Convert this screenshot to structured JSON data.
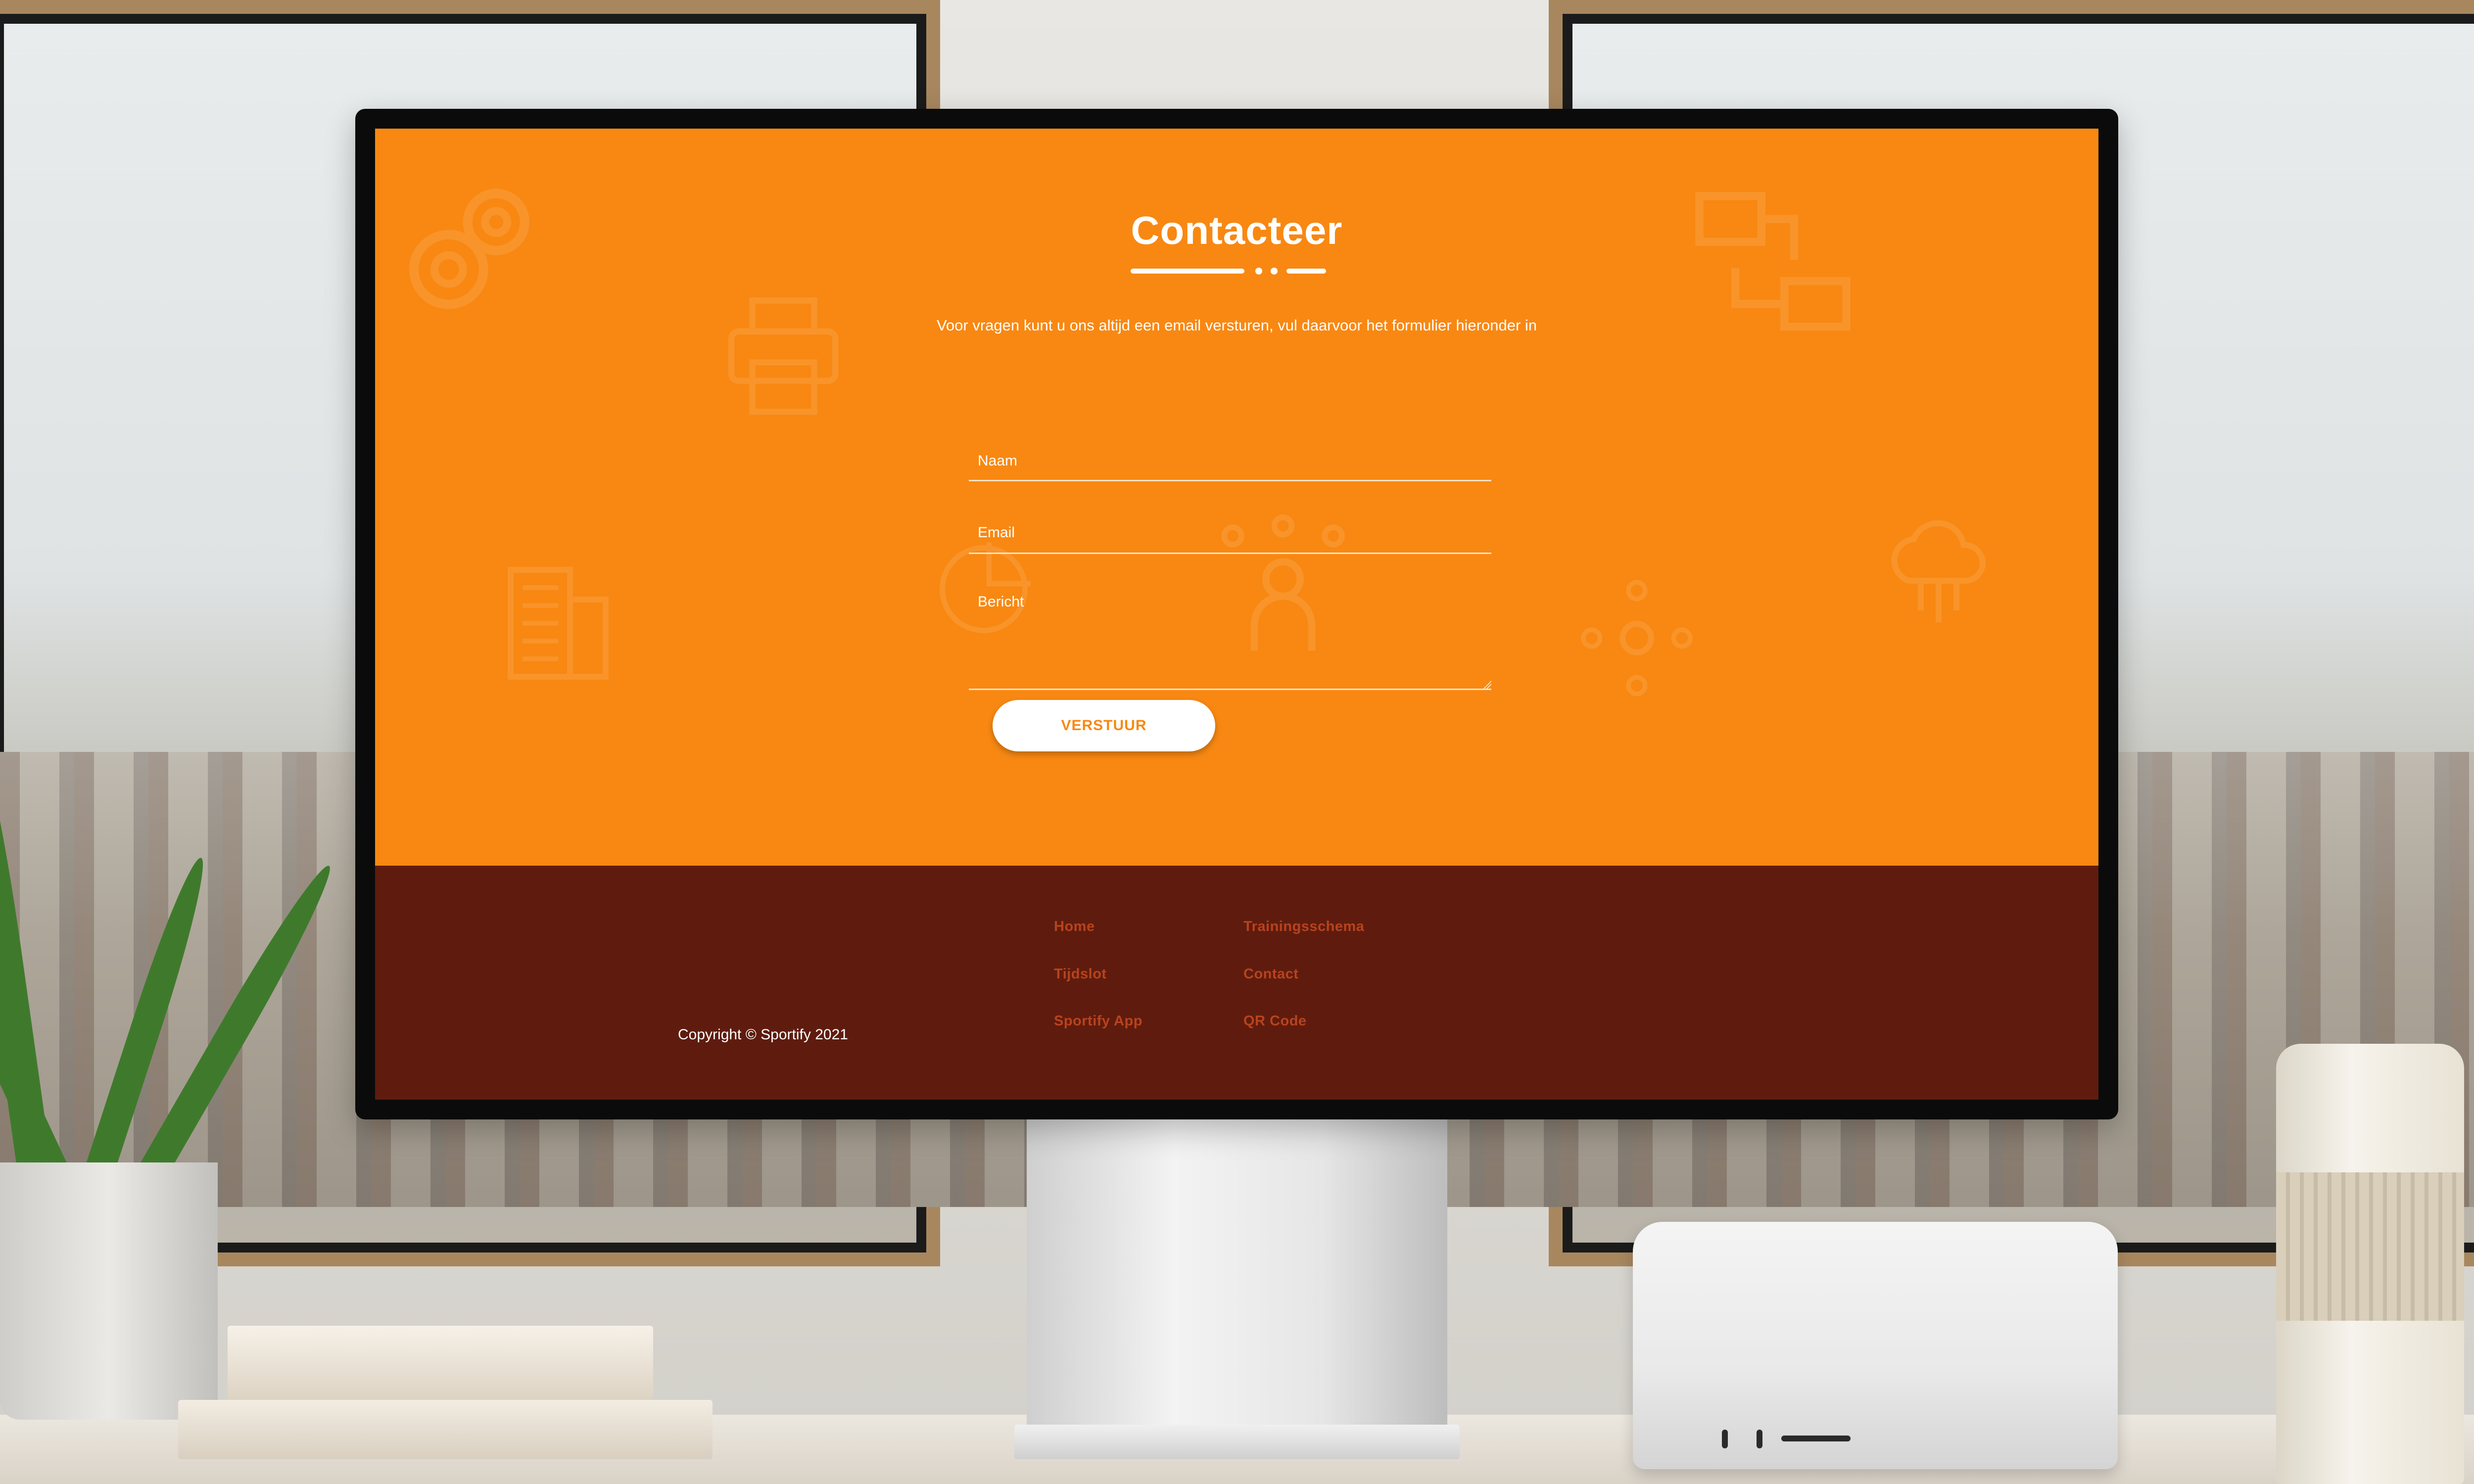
{
  "page": {
    "title": "Contacteer",
    "intro": "Voor vragen kunt u ons altijd een email versturen, vul daarvoor het formulier hieronder in"
  },
  "form": {
    "name_placeholder": "Naam",
    "email_placeholder": "Email",
    "message_placeholder": "Bericht",
    "submit_label": "VERSTUUR"
  },
  "footer": {
    "copyright": "Copyright © Sportify 2021",
    "links": [
      "Home",
      "Trainingsschema",
      "Tijdslot",
      "Contact",
      "Sportify App",
      "QR Code"
    ]
  },
  "colors": {
    "accent": "#f88812",
    "footer_bg": "#5f1c0e",
    "footer_link": "#b8431e"
  },
  "icons": [
    "gears-icon",
    "printer-icon",
    "building-icon",
    "pie-chart-icon",
    "network-person-icon",
    "hub-icon",
    "flow-monitors-icon",
    "cloud-network-icon"
  ]
}
